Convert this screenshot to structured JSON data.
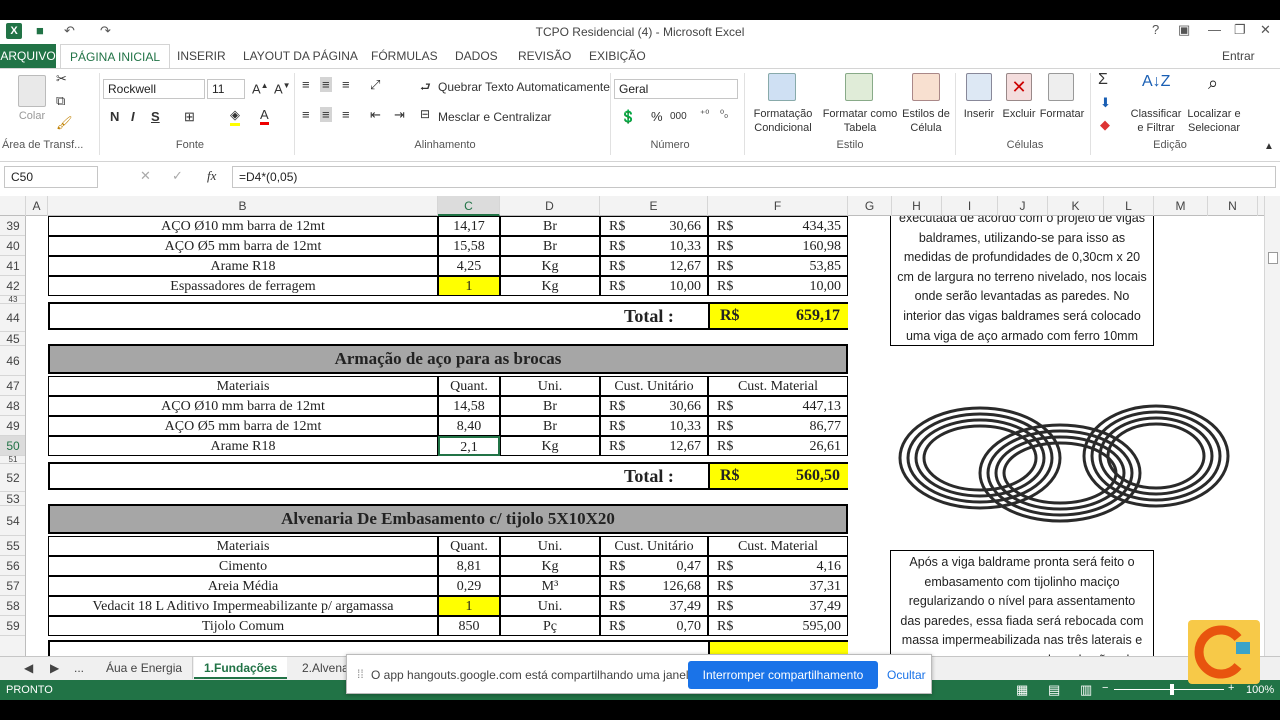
{
  "window": {
    "title": "TCPO Residencial  (4) - Microsoft Excel",
    "help": "?",
    "signin": "Entrar"
  },
  "qat": {
    "undo": "↶",
    "redo": "↷",
    "save": "💾"
  },
  "tabs": [
    "ARQUIVO",
    "PÁGINA INICIAL",
    "INSERIR",
    "LAYOUT DA PÁGINA",
    "FÓRMULAS",
    "DADOS",
    "REVISÃO",
    "EXIBIÇÃO"
  ],
  "ribbon": {
    "clipboard": {
      "paste": "Colar",
      "group": "Área de Transf..."
    },
    "font": {
      "name": "Rockwell",
      "size": "11",
      "bold": "N",
      "italic": "I",
      "underline": "S",
      "group": "Fonte"
    },
    "alignment": {
      "wrap": "Quebrar Texto Automaticamente",
      "merge": "Mesclar e Centralizar",
      "group": "Alinhamento"
    },
    "number": {
      "format": "Geral",
      "percent": "%",
      "thousands": "000",
      "group": "Número"
    },
    "styles": {
      "cond": "Formatação Condicional",
      "table": "Formatar como Tabela",
      "cell": "Estilos de Célula",
      "group": "Estilo"
    },
    "cells": {
      "insert": "Inserir",
      "delete": "Excluir",
      "format": "Formatar",
      "group": "Células"
    },
    "editing": {
      "sort": "Classificar e Filtrar",
      "find": "Localizar e Selecionar",
      "group": "Edição"
    }
  },
  "formula_bar": {
    "namebox": "C50",
    "fx": "fx",
    "formula": "=D4*(0,05)"
  },
  "columns": [
    "A",
    "B",
    "C",
    "D",
    "E",
    "F",
    "G",
    "H",
    "I",
    "J",
    "K",
    "L",
    "M",
    "N"
  ],
  "rows": [
    "39",
    "40",
    "41",
    "42",
    "43",
    "44",
    "45",
    "46",
    "47",
    "48",
    "49",
    "50",
    "51",
    "52",
    "53",
    "54",
    "55",
    "56",
    "57",
    "58",
    "59"
  ],
  "section1": {
    "items": [
      {
        "mat": "AÇO Ø10 mm barra de 12mt",
        "q": "14,17",
        "u": "Br",
        "cur": "R$",
        "unit": "30,66",
        "cur2": "R$",
        "tot": "434,35"
      },
      {
        "mat": "AÇO Ø5 mm barra de 12mt",
        "q": "15,58",
        "u": "Br",
        "cur": "R$",
        "unit": "10,33",
        "cur2": "R$",
        "tot": "160,98"
      },
      {
        "mat": "Arame R18",
        "q": "4,25",
        "u": "Kg",
        "cur": "R$",
        "unit": "12,67",
        "cur2": "R$",
        "tot": "53,85"
      },
      {
        "mat": "Espassadores de ferragem",
        "q": "1",
        "u": "Kg",
        "cur": "R$",
        "unit": "10,00",
        "cur2": "R$",
        "tot": "10,00"
      }
    ],
    "total_label": "Total :",
    "total_cur": "R$",
    "total": "659,17"
  },
  "section2": {
    "title": "Armação de aço para as brocas",
    "headers": [
      "Materiais",
      "Quant.",
      "Uni.",
      "Cust. Unitário",
      "Cust. Material"
    ],
    "items": [
      {
        "mat": "AÇO Ø10 mm barra de 12mt",
        "q": "14,58",
        "u": "Br",
        "cur": "R$",
        "unit": "30,66",
        "cur2": "R$",
        "tot": "447,13"
      },
      {
        "mat": "AÇO Ø5 mm barra de 12mt",
        "q": "8,40",
        "u": "Br",
        "cur": "R$",
        "unit": "10,33",
        "cur2": "R$",
        "tot": "86,77"
      },
      {
        "mat": "Arame R18",
        "q": "2,1",
        "u": "Kg",
        "cur": "R$",
        "unit": "12,67",
        "cur2": "R$",
        "tot": "26,61"
      }
    ],
    "total_label": "Total :",
    "total_cur": "R$",
    "total": "560,50"
  },
  "section3": {
    "title": "Alvenaria De Embasamento c/ tijolo 5X10X20",
    "headers": [
      "Materiais",
      "Quant.",
      "Uni.",
      "Cust. Unitário",
      "Cust. Material"
    ],
    "items": [
      {
        "mat": "Cimento",
        "q": "8,81",
        "u": "Kg",
        "cur": "R$",
        "unit": "0,47",
        "cur2": "R$",
        "tot": "4,16"
      },
      {
        "mat": "Areia Média",
        "q": "0,29",
        "u": "M³",
        "cur": "R$",
        "unit": "126,68",
        "cur2": "R$",
        "tot": "37,31"
      },
      {
        "mat": "Vedacit 18 L Aditivo Impermeabilizante p/ argamassa",
        "q": "1",
        "u": "Uni.",
        "cur": "R$",
        "unit": "37,49",
        "cur2": "R$",
        "tot": "37,49"
      },
      {
        "mat": "Tijolo Comum",
        "q": "850",
        "u": "Pç",
        "cur": "R$",
        "unit": "0,70",
        "cur2": "R$",
        "tot": "595,00"
      }
    ]
  },
  "textbox1": "executada de acordo com o projeto de vigas baldrames, utilizando-se para isso as medidas de profundidades de 0,30cm x 20 cm de largura no terreno nivelado, nos locais onde serão levantadas as paredes.  No interior das vigas baldrames será colocado uma viga de aço armado com ferro 10mm",
  "textbox2": "Após a viga baldrame pronta será feito o embasamento com tijolinho maciço regularizando o nível para assentamento das paredes, essa fiada será rebocada com massa impermeabilizada nas três laterais e após a secagem passar duas demãos de VEDAPREN",
  "sheet_tabs": [
    "...",
    "Áua e Energia",
    "1.Fundações",
    "2.Alvena"
  ],
  "status": {
    "ready": "PRONTO",
    "zoom": "100%"
  },
  "banner": {
    "msg": "O app hangouts.google.com está compartilhando uma janela.",
    "stop": "Interromper compartilhamento",
    "hide": "Ocultar"
  }
}
